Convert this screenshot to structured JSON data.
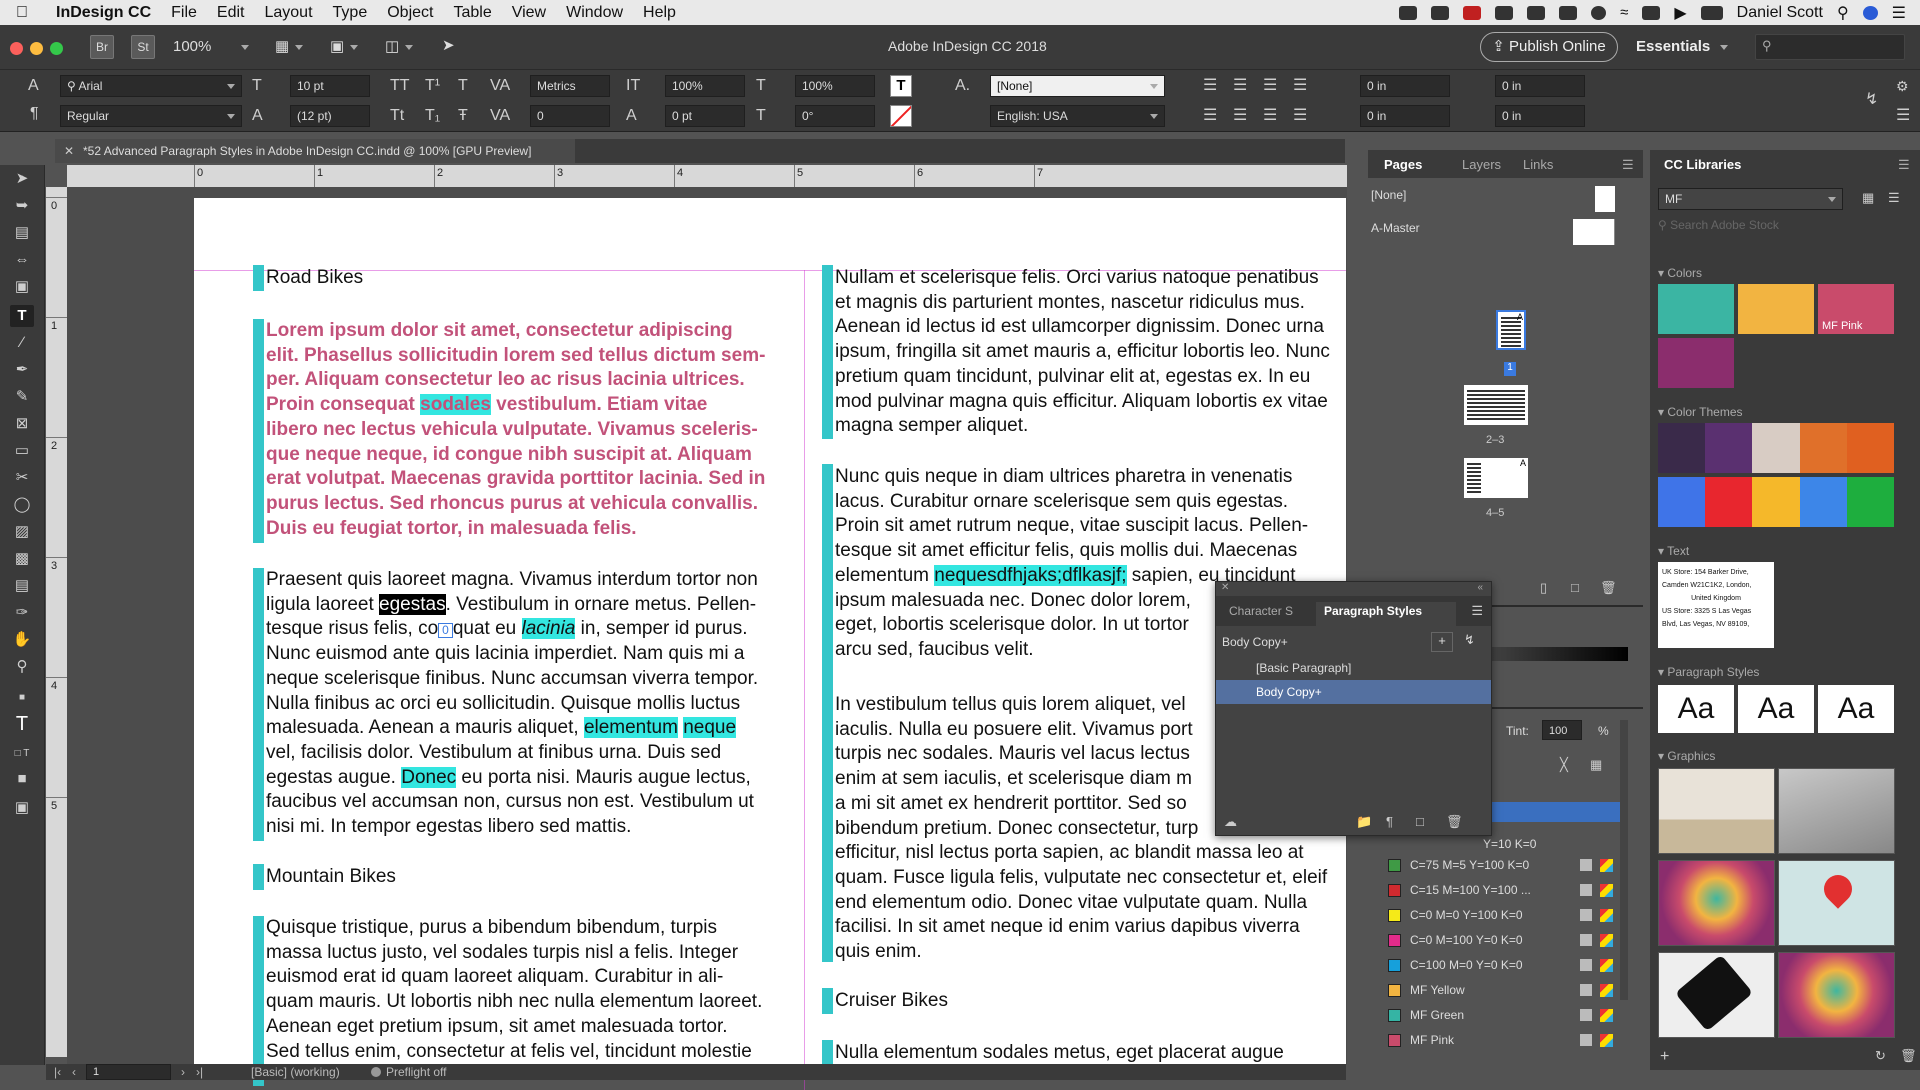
{
  "menubar": {
    "app_name": "InDesign CC",
    "items": [
      "File",
      "Edit",
      "Layout",
      "Type",
      "Object",
      "Table",
      "View",
      "Window",
      "Help"
    ],
    "user": "Daniel Scott"
  },
  "appbar": {
    "br": "Br",
    "st": "St",
    "zoom": "100%",
    "title": "Adobe InDesign CC 2018",
    "publish_label": "Publish Online",
    "workspace": "Essentials"
  },
  "control": {
    "font_family": "Arial",
    "font_style": "Regular",
    "font_size": "10 pt",
    "leading": "(12 pt)",
    "kerning": "Metrics",
    "tracking": "0",
    "vscale": "100%",
    "hscale": "100%",
    "baseline": "0 pt",
    "skew": "0°",
    "char_style": "[None]",
    "language": "English: USA",
    "left_indent": "0 in",
    "right_indent": "0 in",
    "first_indent": "0 in",
    "last_indent": "0 in"
  },
  "document": {
    "tab_title": "*52 Advanced Paragraph Styles in Adobe InDesign CC.indd @ 100% [GPU Preview]",
    "ruler_labels": [
      "0",
      "1",
      "2",
      "3",
      "4",
      "5",
      "6",
      "7"
    ],
    "vruler_labels": [
      "0",
      "1",
      "2",
      "3",
      "4",
      "5"
    ],
    "col1": {
      "heading1": "Road Bikes",
      "pink_lines": [
        "Lorem ipsum dolor sit amet, consectetur adipiscing",
        "elit. Phasellus sollicitudin lorem sed tellus dictum sem-",
        "per. Aliquam consectetur leo ac risus lacinia ultrices.",
        "Proin consequat ",
        "sodales",
        " vestibulum. Etiam vitae",
        "libero nec lectus vehicula vulputate. Vivamus sceleris-",
        "que neque neque, id congue nibh suscipit at. Aliquam",
        "erat volutpat. Maecenas gravida porttitor lacinia. Sed in",
        "purus lectus. Sed rhoncus purus at vehicula convallis.",
        "Duis eu feugiat tortor, in malesuada felis."
      ],
      "para2": [
        "Praesent quis laoreet magna. Vivamus interdum tortor non",
        "ligula laoreet ",
        "egestas",
        ". Vestibulum in ornare metus. Pellen-",
        "tesque risus felis, co",
        "quat eu ",
        "lacinia",
        " in, semper id purus.",
        "Nunc euismod ante quis lacinia imperdiet. Nam quis mi a",
        "neque scelerisque finibus. Nunc accumsan viverra tempor.",
        "Nulla finibus ac orci eu sollicitudin. Quisque mollis luctus",
        "malesuada. Aenean a mauris aliquet, ",
        "elementum",
        "neque",
        "vel, facilisis dolor. Vestibulum at finibus urna. Duis sed",
        "egestas augue. ",
        "Donec",
        " eu porta nisi. Mauris augue lectus,",
        "faucibus vel accumsan non, cursus non est. Vestibulum ut",
        "nisi mi. In tempor egestas libero sed mattis."
      ],
      "heading2": "Mountain Bikes",
      "para3": [
        "Quisque tristique, purus a bibendum bibendum, turpis",
        "massa luctus justo, vel sodales turpis nisl a felis. Integer",
        "euismod erat id quam laoreet aliquam. Curabitur in ali-",
        "quam mauris. Ut lobortis nibh nec nulla elementum laoreet.",
        "Aenean eget pretium ipsum, sit amet malesuada tortor.",
        "Sed tellus enim, consectetur at felis vel, tincidunt molestie"
      ]
    },
    "col2": {
      "para1": [
        "Nullam et scelerisque felis. Orci varius natoque penatibus",
        "et magnis dis parturient montes, nascetur ridiculus mus.",
        "Aenean id lectus id est ullamcorper dignissim. Donec urna",
        "ipsum, fringilla sit amet mauris a, efficitur lobortis leo. Nunc",
        "pretium quam tincidunt, pulvinar elit at, egestas ex. In eu",
        "mod pulvinar magna quis efficitur. Aliquam lobortis ex vitae",
        "magna semper aliquet."
      ],
      "para2": [
        "Nunc quis neque in diam ultrices pharetra in venenatis",
        "lacus. Curabitur ornare scelerisque sem quis egestas.",
        "Proin sit amet rutrum neque, vitae suscipit lacus. Pellen-",
        "tesque sit amet efficitur felis, quis mollis dui. Maecenas",
        "elementum ",
        "nequesdfhjaks;dflkasjf;",
        " sapien, eu tincidunt",
        "ipsum malesuada nec. Donec dolor lorem,",
        "eget, lobortis scelerisque dolor. In ut tortor",
        "arcu sed, faucibus velit."
      ],
      "para3": [
        "In vestibulum tellus quis lorem aliquet, vel",
        "iaculis. Nulla eu posuere elit. Vivamus port",
        "turpis nec sodales. Mauris vel lacus lectus",
        "enim at sem iaculis, et scelerisque diam m",
        "a mi sit amet ex hendrerit porttitor. Sed so",
        "bibendum pretium. Donec consectetur, turp",
        "efficitur, nisl lectus porta sapien, ac blandit massa leo at",
        "quam. Fusce ligula felis, vulputate nec consectetur et, eleif",
        "end elementum odio. Donec vitae vulputate quam. Nulla",
        "facilisi. In sit amet neque id enim varius dapibus viverra",
        "quis enim."
      ],
      "heading3": "Cruiser Bikes",
      "para4": "Nulla elementum sodales metus, eget placerat augue"
    },
    "overset_marker": "0"
  },
  "pages_panel": {
    "tabs": [
      "Pages",
      "Layers",
      "Links"
    ],
    "none_label": "[None]",
    "master_label": "A-Master",
    "page_labels": [
      "1",
      "2–3",
      "4–5"
    ],
    "spread_letter": "A",
    "tint_label": "Tint:",
    "tint_value": "100",
    "tint_unit": "%",
    "swatches": [
      {
        "name": "C=75 M=5 Y=100 K=0",
        "color": "#3f9a45"
      },
      {
        "name": "C=15 M=100 Y=100 ...",
        "color": "#d02a2f"
      },
      {
        "name": "C=0 M=0 Y=100 K=0",
        "color": "#f5ea18"
      },
      {
        "name": "C=0 M=100 Y=0 K=0",
        "color": "#e22b8a"
      },
      {
        "name": "C=100 M=0 Y=0 K=0",
        "color": "#16a0db"
      },
      {
        "name": "MF Yellow",
        "color": "#f2b441"
      },
      {
        "name": "MF Green",
        "color": "#35b4a4"
      },
      {
        "name": "MF Pink",
        "color": "#c94b6b"
      }
    ],
    "partial_swatch": "Y=10 K=0"
  },
  "paragraph_styles_panel": {
    "tabs": [
      "Character S",
      "Paragraph Styles"
    ],
    "current": "Body Copy+",
    "items": [
      "[Basic Paragraph]",
      "Body Copy+"
    ]
  },
  "cc_libraries": {
    "title": "CC Libraries",
    "library": "MF",
    "search_placeholder": "Search Adobe Stock",
    "colors_label": "Colors",
    "colors": [
      "#3bb5a3",
      "#f2b441",
      "#c94b6b",
      "#8b2d6d"
    ],
    "mf_pink_label": "MF Pink",
    "themes_label": "Color Themes",
    "theme1": [
      "#3a2a4a",
      "#5a3070",
      "#d8ccc4",
      "#e0702a",
      "#e06020"
    ],
    "theme2": [
      "#3f74e8",
      "#e8262e",
      "#f5b82a",
      "#3d86e8",
      "#1eae3e"
    ],
    "text_label": "Text",
    "text_snippet": [
      "UK Store: 154 Barker Drive,",
      "Camden W21C1K2, London,",
      "United Kingdom",
      "US Store: 3325 S Las Vegas",
      "Blvd, Las Vegas, NV 89109,"
    ],
    "pstyles_label": "Paragraph Styles",
    "aa": "Aa",
    "graphics_label": "Graphics"
  },
  "statusbar": {
    "page": "1",
    "style": "[Basic] (working)",
    "preflight": "Preflight off"
  }
}
